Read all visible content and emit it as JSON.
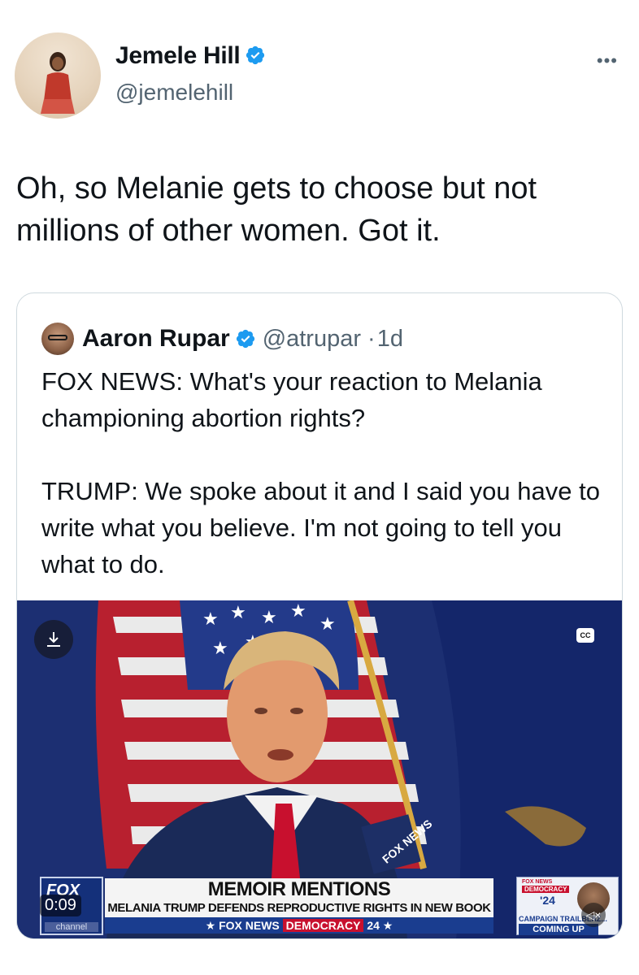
{
  "author": {
    "name": "Jemele Hill",
    "handle": "@jemelehill"
  },
  "tweet": {
    "text": "Oh, so Melanie gets to choose but not millions of other women. Got it."
  },
  "quote": {
    "name": "Aaron Rupar",
    "handle": "@atrupar",
    "separator": "·",
    "time": "1d",
    "text": "FOX NEWS: What's your reaction to Melania championing abortion rights?\n\nTRUMP: We spoke about it and I said you have to write what you believe. I'm not going to tell you what to do."
  },
  "video": {
    "timestamp": "0:09",
    "cc_label": "CC",
    "bug_logo": "FOX",
    "bug_channel": "channel",
    "headline_title": "MEMOIR MENTIONS",
    "headline_sub": "MELANIA TRUMP DEFENDS REPRODUCTIVE RIGHTS IN NEW BOOK",
    "brand_left": "★ FOX NEWS",
    "brand_democracy": "DEMOCRACY",
    "brand_right": "24 ★",
    "promo_top": "FOX NEWS",
    "promo_democracy": "DEMOCRACY",
    "promo_24": "'24",
    "promo_trail": "CAMPAIGN TRAILBLAZ...",
    "promo_coming": "COMING UP"
  },
  "colors": {
    "verified": "#1d9bf0",
    "text_secondary": "#536471",
    "border": "#cfd9de"
  },
  "icons": {
    "verified": "verified-badge-icon",
    "more": "more-dots-icon",
    "download": "download-icon",
    "mute": "mute-icon"
  }
}
